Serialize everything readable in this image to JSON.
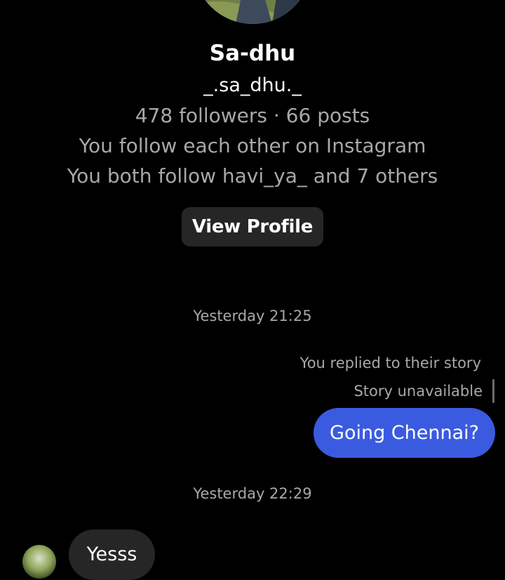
{
  "profile": {
    "name": "Sa-dhu",
    "username": "_.sa_dhu._",
    "stats": "478 followers · 66 posts",
    "mutual_follow": "You follow each other on Instagram",
    "mutual_friends": "You both follow havi_ya_ and 7 others",
    "view_profile_label": "View Profile"
  },
  "messages": {
    "timestamp_1": "Yesterday 21:25",
    "story_reply_note": "You replied to their story",
    "story_unavailable": "Story unavailable",
    "outgoing_text": "Going Chennai?",
    "timestamp_2": "Yesterday 22:29",
    "incoming_text": "Yesss"
  },
  "colors": {
    "background": "#000000",
    "outgoing_bubble": "#3a5be0",
    "incoming_bubble": "#262626",
    "secondary_text": "#a8a8a8"
  }
}
